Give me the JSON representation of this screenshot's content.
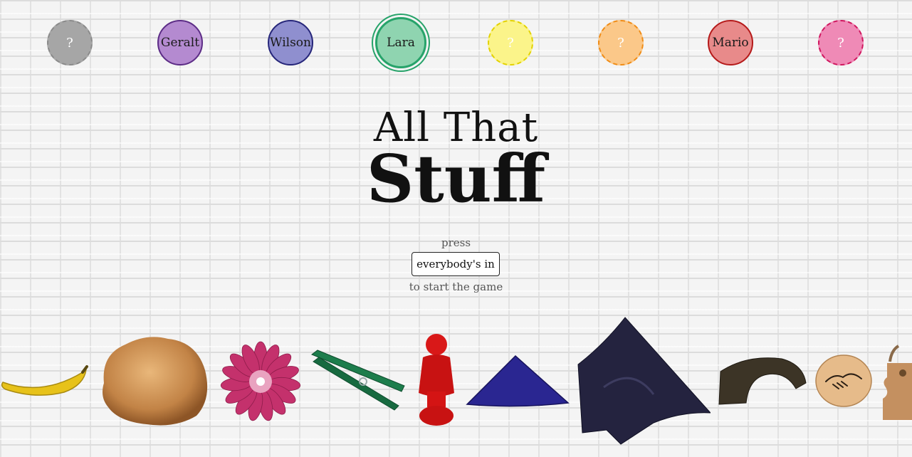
{
  "players": [
    {
      "name": "?",
      "state": "empty",
      "color": "#a6a6a6",
      "border": "#8a8a8a"
    },
    {
      "name": "Geralt",
      "state": "joined",
      "color": "#b48ad0",
      "border": "#5c2c86"
    },
    {
      "name": "Wilson",
      "state": "joined",
      "color": "#8f8fcf",
      "border": "#26267a"
    },
    {
      "name": "Lara",
      "state": "selected",
      "color": "#8fd4b0",
      "border": "#27a36a"
    },
    {
      "name": "?",
      "state": "empty",
      "color": "#fbf48a",
      "border": "#e3d200"
    },
    {
      "name": "?",
      "state": "empty",
      "color": "#fbc889",
      "border": "#f08c16"
    },
    {
      "name": "Mario",
      "state": "joined",
      "color": "#e88a8a",
      "border": "#b51a1a"
    },
    {
      "name": "?",
      "state": "empty",
      "color": "#ef8ab6",
      "border": "#d0175f"
    }
  ],
  "title": {
    "line1": "All That",
    "line2": "Stuff"
  },
  "instructions": {
    "before": "press",
    "button": "everybody's in",
    "after": "to start the game"
  },
  "items": [
    "banana",
    "fur-ball",
    "pink-flower",
    "clothespin",
    "red-figurine",
    "blue-triangle",
    "dark-cloth",
    "wooden-arch",
    "handshake-token",
    "puzzle-piece"
  ]
}
